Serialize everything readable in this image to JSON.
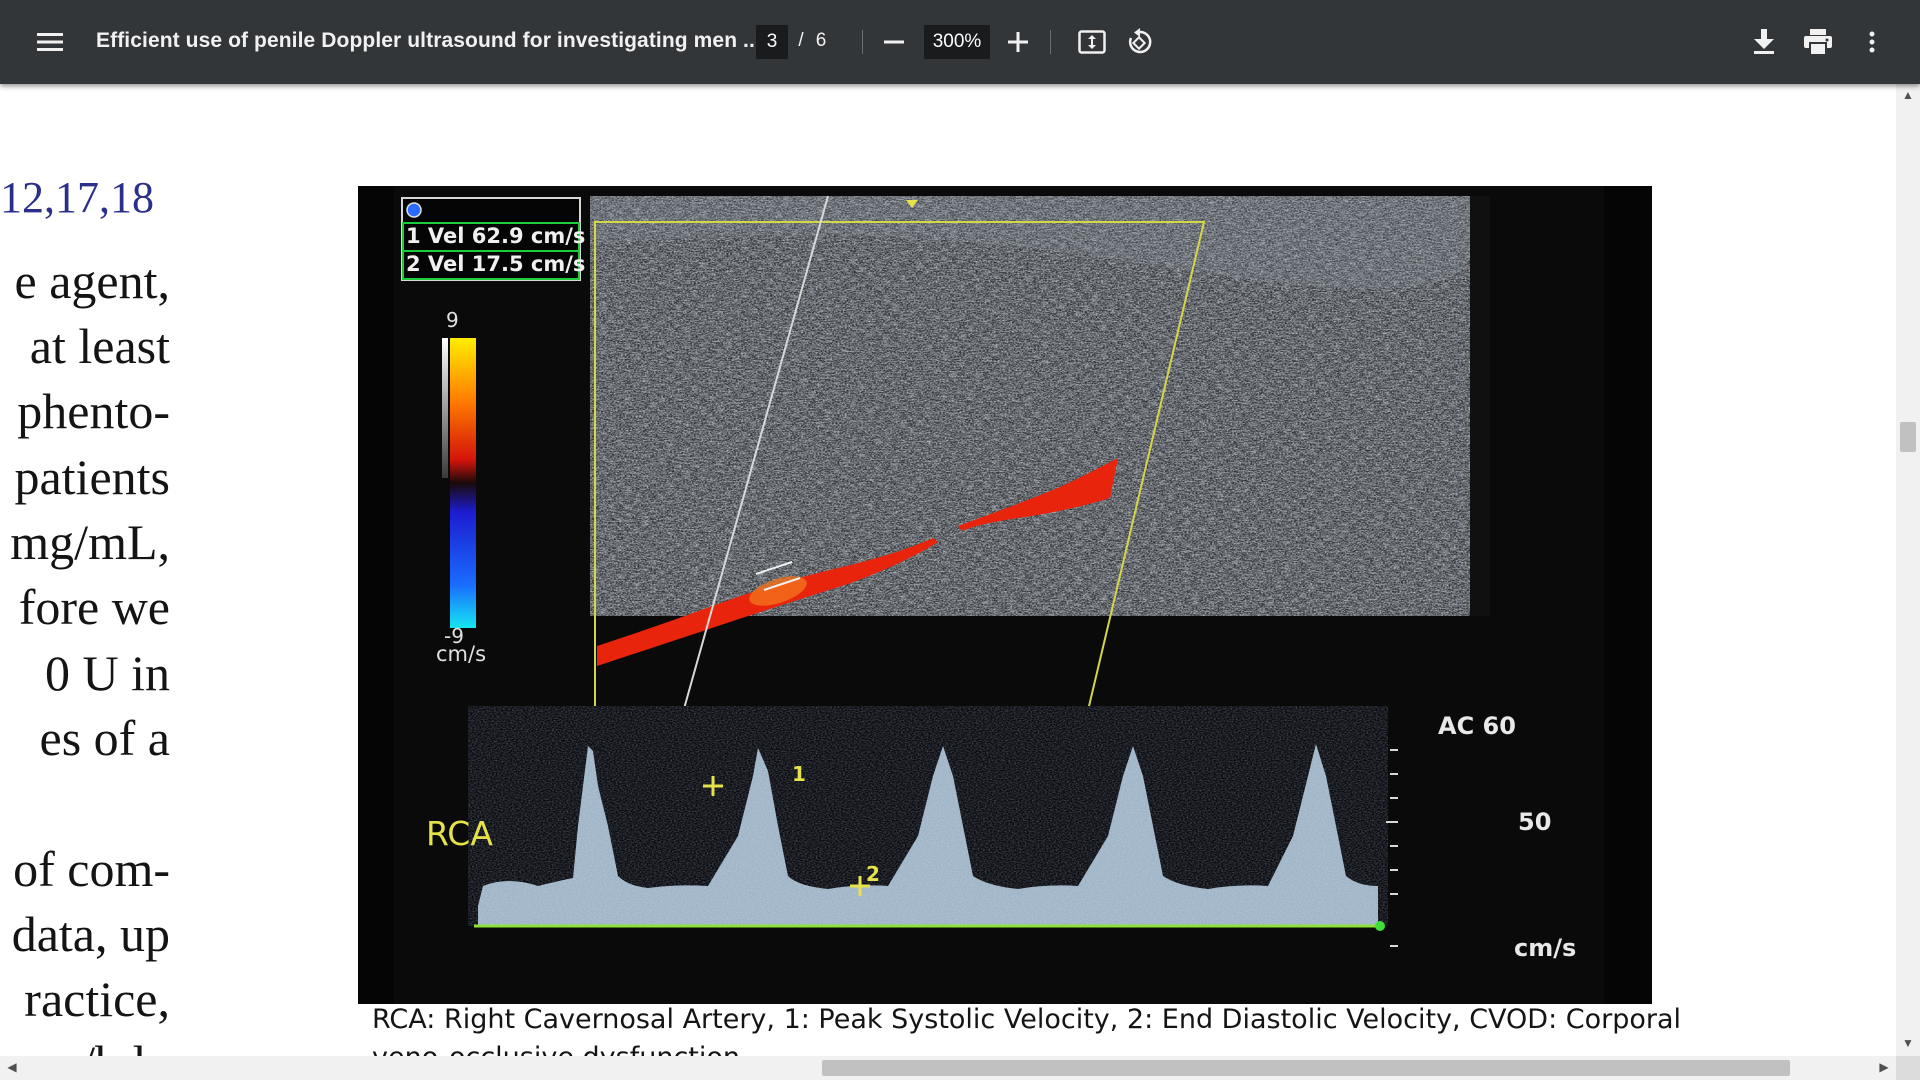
{
  "toolbar": {
    "title": "Efficient use of penile Doppler ultrasound for investigating men ...",
    "page_current": "3",
    "page_sep": "/",
    "page_total": "6",
    "zoom": "300%"
  },
  "document": {
    "refs": "12,17,18",
    "lines": [
      "e agent,",
      "at least",
      "phento-",
      "patients",
      "mg/mL,",
      "fore we",
      "0 U in",
      "es of a",
      "of com-",
      "data, up",
      "ractice,",
      "y/bd.."
    ],
    "caption": "RCA: Right Cavernosal Artery, 1: Peak Systolic Velocity, 2: End Diastolic Velocity, CVOD: Corporal",
    "caption_line2": "veno-occlusive dysfunction"
  },
  "figure": {
    "vel1": "1  Vel  62.9 cm/s",
    "vel2": "2  Vel  17.5 cm/s",
    "scale_top": "9",
    "scale_bottom": "-9",
    "scale_unit": "cm/s",
    "rca_label": "RCA",
    "ac_label": "AC 60",
    "spectral_scale": "50",
    "spectral_unit": "cm/s",
    "marker1": "1",
    "marker2": "2"
  },
  "colors": {
    "toolbar_bg": "#323639",
    "link_blue": "#2b2f8a",
    "flow_red": "#e8240c",
    "label_yellow": "#e6e24a"
  }
}
